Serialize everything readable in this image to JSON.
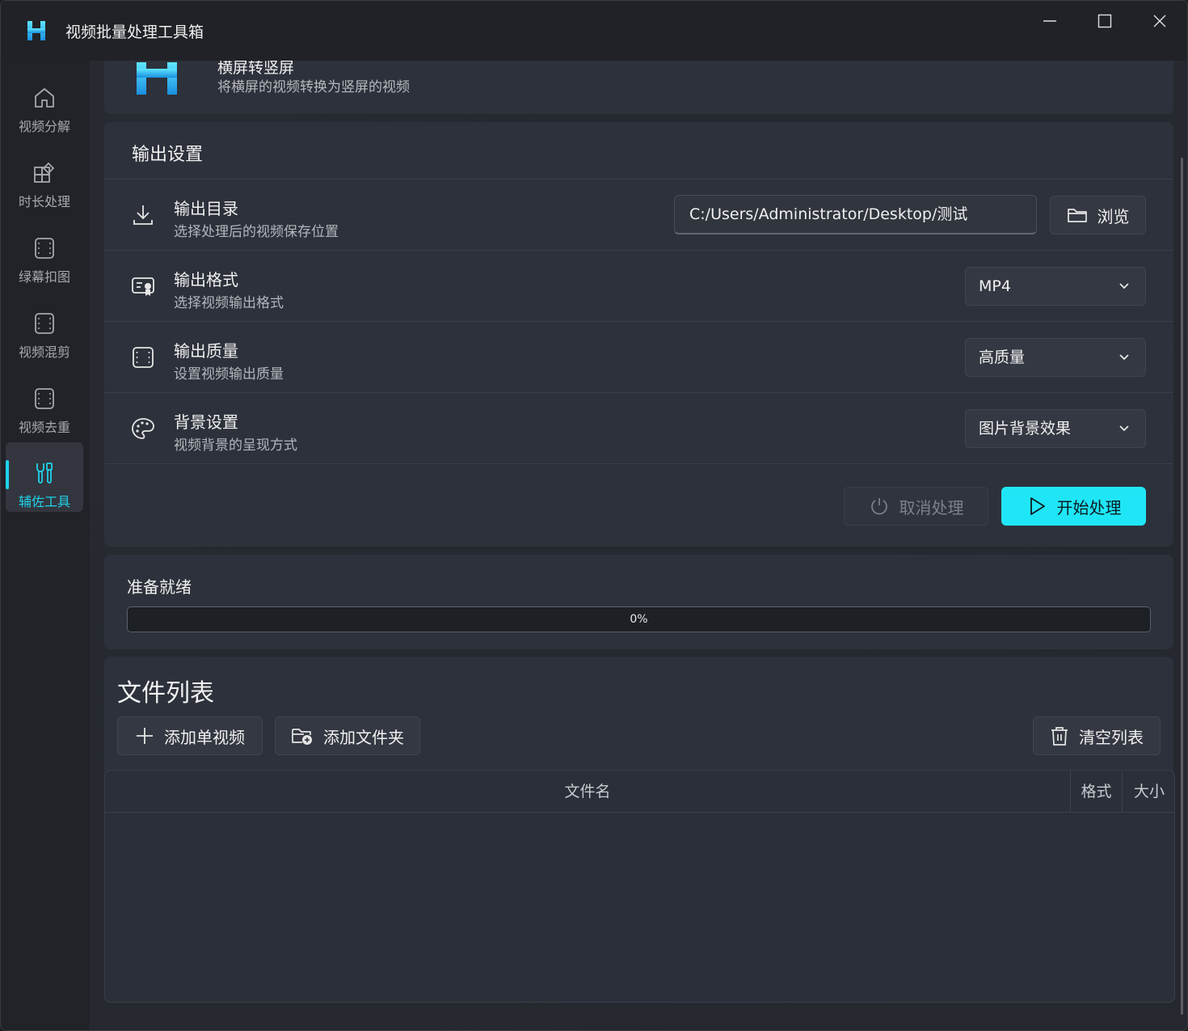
{
  "window": {
    "title": "视频批量处理工具箱"
  },
  "sidebar": {
    "items": [
      {
        "label": "视频分解",
        "icon": "home-icon"
      },
      {
        "label": "时长处理",
        "icon": "apps-add-icon"
      },
      {
        "label": "绿幕扣图",
        "icon": "film-frame-icon"
      },
      {
        "label": "视频混剪",
        "icon": "film-frame-icon"
      },
      {
        "label": "视频去重",
        "icon": "film-frame-icon"
      },
      {
        "label": "辅佐工具",
        "icon": "tools-icon",
        "active": true
      }
    ]
  },
  "hero": {
    "title": "横屏转竖屏",
    "subtitle": "将横屏的视频转换为竖屏的视频"
  },
  "output": {
    "section_title": "输出设置",
    "directory": {
      "title": "输出目录",
      "subtitle": "选择处理后的视频保存位置",
      "value": "C:/Users/Administrator/Desktop/测试",
      "browse_label": "浏览"
    },
    "format": {
      "title": "输出格式",
      "subtitle": "选择视频输出格式",
      "selected": "MP4"
    },
    "quality": {
      "title": "输出质量",
      "subtitle": "设置视频输出质量",
      "selected": "高质量"
    },
    "background": {
      "title": "背景设置",
      "subtitle": "视频背景的呈现方式",
      "selected": "图片背景效果"
    },
    "cancel_label": "取消处理",
    "start_label": "开始处理"
  },
  "progress": {
    "label": "准备就绪",
    "percent_text": "0%",
    "value": 0
  },
  "files": {
    "title": "文件列表",
    "add_video_label": "添加单视频",
    "add_folder_label": "添加文件夹",
    "clear_label": "清空列表",
    "columns": [
      "文件名",
      "格式",
      "大小"
    ],
    "rows": []
  },
  "colors": {
    "accent": "#1fd3ea",
    "start_button": "#1fe6f6"
  }
}
